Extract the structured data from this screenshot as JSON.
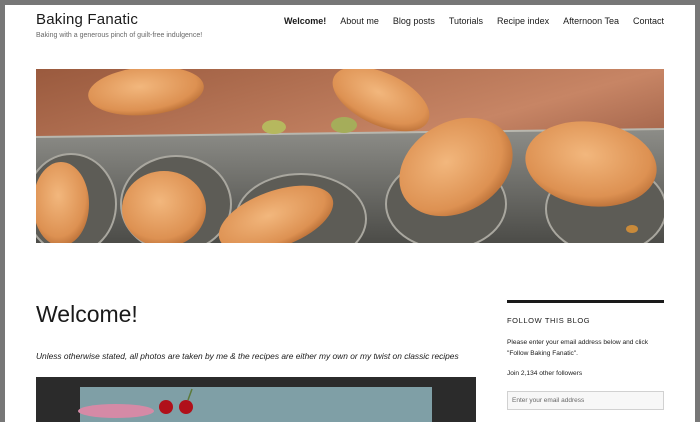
{
  "site": {
    "title": "Baking Fanatic",
    "tagline": "Baking with a generous pinch of guilt-free indulgence!"
  },
  "nav": {
    "items": [
      {
        "label": "Welcome!",
        "active": true
      },
      {
        "label": "About me"
      },
      {
        "label": "Blog posts"
      },
      {
        "label": "Tutorials"
      },
      {
        "label": "Recipe index"
      },
      {
        "label": "Afternoon Tea"
      },
      {
        "label": "Contact"
      }
    ]
  },
  "main": {
    "page_title": "Welcome!",
    "intro": "Unless otherwise stated, all photos are taken by me & the recipes are either my own or my twist on classic recipes"
  },
  "sidebar": {
    "widget_title": "FOLLOW THIS BLOG",
    "text": "Please enter your email address below and click \"Follow Baking Fanatic\".",
    "followers": "Join 2,134 other followers",
    "email_placeholder": "Enter your email address"
  }
}
